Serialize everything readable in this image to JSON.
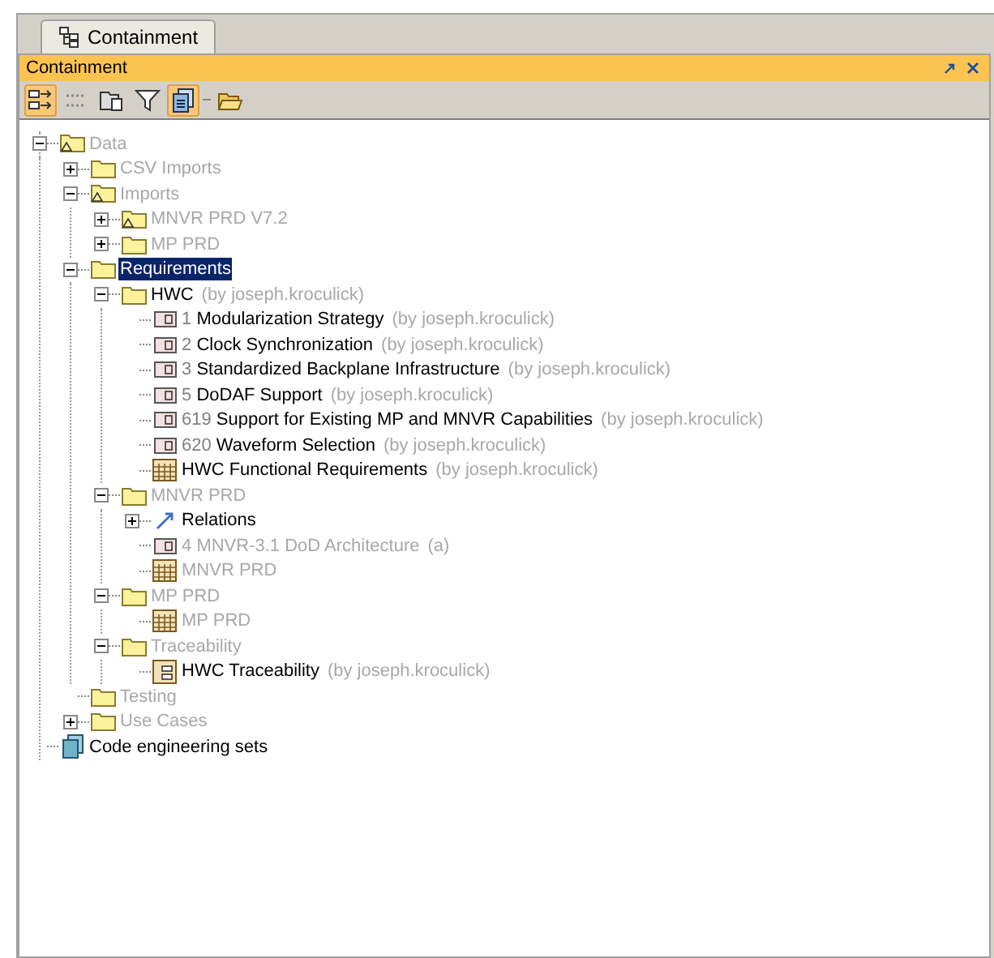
{
  "tab": {
    "label": "Containment",
    "selected": true
  },
  "panel": {
    "title": "Containment"
  },
  "toolbar": [
    {
      "kind": "arrange",
      "selected": true
    },
    {
      "kind": "dots",
      "selected": false
    },
    {
      "kind": "folder-doc",
      "selected": false
    },
    {
      "kind": "filter",
      "selected": false
    },
    {
      "kind": "docs",
      "selected": true
    },
    {
      "kind": "separator",
      "selected": false
    },
    {
      "kind": "open-folder",
      "selected": false
    }
  ],
  "tree": [
    {
      "kind": "package-warning",
      "label": "Data",
      "dimmed": true,
      "selected": false,
      "expanded": true,
      "children": [
        {
          "kind": "folder",
          "label": "CSV Imports",
          "dimmed": true,
          "selected": false,
          "expanded": false
        },
        {
          "kind": "package-warning",
          "label": "Imports",
          "dimmed": true,
          "selected": false,
          "expanded": true,
          "children": [
            {
              "kind": "package-warning",
              "label": "MNVR PRD V7.2",
              "dimmed": true,
              "selected": false,
              "expanded": false
            },
            {
              "kind": "folder",
              "label": "MP PRD",
              "dimmed": true,
              "selected": false,
              "expanded": false
            }
          ]
        },
        {
          "kind": "folder",
          "label": "Requirements",
          "selected": true,
          "expanded": true,
          "children": [
            {
              "kind": "folder",
              "label": "HWC",
              "note": "(by joseph.kroculick)",
              "dimmed": false,
              "selected": false,
              "expanded": true,
              "children": [
                {
                  "kind": "requirement",
                  "number": "1",
                  "label": "Modularization Strategy",
                  "note": "(by joseph.kroculick)",
                  "dimmed": false,
                  "selected": false
                },
                {
                  "kind": "requirement",
                  "number": "2",
                  "label": "Clock Synchronization",
                  "note": "(by joseph.kroculick)",
                  "dimmed": false,
                  "selected": false
                },
                {
                  "kind": "requirement",
                  "number": "3",
                  "label": "Standardized Backplane Infrastructure",
                  "note": "(by joseph.kroculick)",
                  "dimmed": false,
                  "selected": false
                },
                {
                  "kind": "requirement",
                  "number": "5",
                  "label": "DoDAF Support",
                  "note": "(by joseph.kroculick)",
                  "dimmed": false,
                  "selected": false
                },
                {
                  "kind": "requirement",
                  "number": "619",
                  "label": "Support for Existing MP and MNVR Capabilities",
                  "note": "(by joseph.kroculick)",
                  "dimmed": false,
                  "selected": false
                },
                {
                  "kind": "requirement",
                  "number": "620",
                  "label": "Waveform Selection",
                  "note": "(by joseph.kroculick)",
                  "dimmed": false,
                  "selected": false
                },
                {
                  "kind": "table",
                  "label": "HWC Functional Requirements",
                  "note": "(by joseph.kroculick)",
                  "dimmed": false,
                  "selected": false
                }
              ]
            },
            {
              "kind": "folder",
              "label": "MNVR PRD",
              "dimmed": true,
              "selected": false,
              "expanded": true,
              "children": [
                {
                  "kind": "relations",
                  "label": "Relations",
                  "dimmed": false,
                  "selected": false,
                  "expanded": false
                },
                {
                  "kind": "requirement",
                  "number": "4",
                  "label": "MNVR-3.1 DoD Architecture",
                  "note": "(a)",
                  "dimmed": true,
                  "selected": false
                },
                {
                  "kind": "table",
                  "label": "MNVR PRD",
                  "dimmed": true,
                  "selected": false
                }
              ]
            },
            {
              "kind": "folder",
              "label": "MP PRD",
              "dimmed": true,
              "selected": false,
              "expanded": true,
              "children": [
                {
                  "kind": "table",
                  "label": "MP PRD",
                  "dimmed": true,
                  "selected": false
                }
              ]
            },
            {
              "kind": "folder",
              "label": "Traceability",
              "dimmed": true,
              "selected": false,
              "expanded": true,
              "children": [
                {
                  "kind": "matrix",
                  "label": "HWC Traceability",
                  "note": "(by joseph.kroculick)",
                  "dimmed": false,
                  "selected": false
                }
              ]
            }
          ]
        },
        {
          "kind": "folder",
          "label": "Testing",
          "dimmed": true,
          "selected": false
        },
        {
          "kind": "folder",
          "label": "Use Cases",
          "dimmed": true,
          "selected": false,
          "expanded": false
        }
      ]
    },
    {
      "kind": "code-sets",
      "label": "Code engineering sets",
      "dimmed": false,
      "selected": false
    }
  ]
}
